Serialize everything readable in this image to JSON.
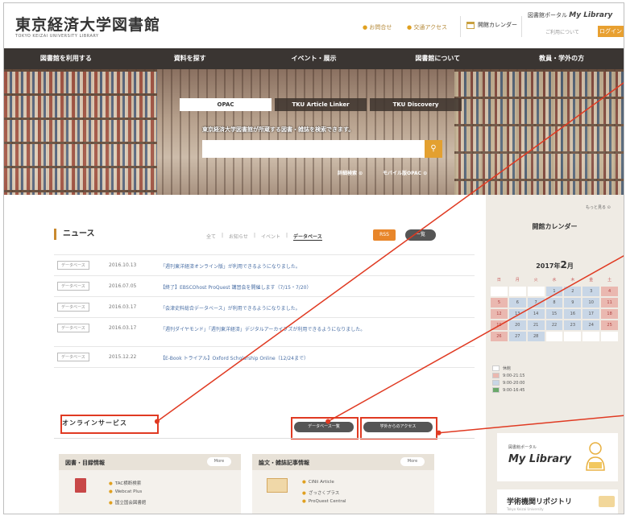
{
  "header": {
    "logo": "東京経済大学図書館",
    "logo_sub": "TOKYO KEIZAI UNIVERSITY LIBRARY",
    "links": [
      "お問合せ",
      "交通アクセス"
    ],
    "calendar_link": "開館カレンダー",
    "mylibrary_label": "図書館ポータル",
    "mylibrary_name": "My Library",
    "mylibrary_guide": "ご利用について",
    "login": "ログイン"
  },
  "nav": [
    "図書館を利用する",
    "資料を探す",
    "イベント・展示",
    "図書館について",
    "教員・学外の方"
  ],
  "search": {
    "tabs": [
      "OPAC",
      "TKU Article Linker",
      "TKU Discovery"
    ],
    "description": "東京経済大学図書館が所蔵する図書・雑誌を検索できます。",
    "button_icon": "search-icon",
    "advanced": "詳細検索",
    "mobile": "モバイル版OPAC"
  },
  "news": {
    "title": "ニュース",
    "filters": [
      "全て",
      "お知らせ",
      "イベント",
      "データベース"
    ],
    "rss": "RSS",
    "all": "一覧",
    "items": [
      {
        "tag": "データベース",
        "date": "2016.10.13",
        "text": "「週刊東洋経済オンライン版」が利用できるようになりました。"
      },
      {
        "tag": "データベース",
        "date": "2016.07.05",
        "text": "【終了】EBSCOhost ProQuest 講習会を開催します（7/15・7/20）"
      },
      {
        "tag": "データベース",
        "date": "2016.03.17",
        "text": "「会津史料総合データベース」が利用できるようになりました。"
      },
      {
        "tag": "データベース",
        "date": "2016.03.17",
        "text": "「週刊ダイヤモンド」「週刊東洋経済」デジタルアーカイブズが利用できるようになりました。"
      },
      {
        "tag": "データベース",
        "date": "2015.12.22",
        "text": "【E-Book トライアル】Oxford Scholarship Online（12/24まで）"
      }
    ]
  },
  "online": {
    "title": "オンラインサービス",
    "db_button": "データベース一覧",
    "offcampus_button": "学外からのアクセス",
    "panels": [
      {
        "title": "図書・目録情報",
        "more": "More",
        "items": [
          "TAC横断検索",
          "Webcat Plus",
          "国立国会図書館"
        ]
      },
      {
        "title": "論文・雑誌記事情報",
        "more": "More",
        "items": [
          "CiNii Article",
          "ざっさくプラス",
          "ProQuest Central"
        ]
      }
    ]
  },
  "sidebar": {
    "more": "もっと見る",
    "calendar_title": "開館カレンダー",
    "year_month_prefix": "2017年",
    "month": "2",
    "month_suffix": "月",
    "weekdays": [
      "日",
      "月",
      "火",
      "水",
      "木",
      "金",
      "土"
    ],
    "weeks": [
      [
        "",
        "",
        "",
        "1",
        "2",
        "3",
        "4"
      ],
      [
        "5",
        "6",
        "7",
        "8",
        "9",
        "10",
        "11"
      ],
      [
        "12",
        "13",
        "14",
        "15",
        "16",
        "17",
        "18"
      ],
      [
        "19",
        "20",
        "21",
        "22",
        "23",
        "24",
        "25"
      ],
      [
        "26",
        "27",
        "28",
        "",
        "",
        "",
        ""
      ]
    ],
    "legend": [
      "休館",
      "9:00-21:15",
      "9:00-20:00",
      "9:00-16:45"
    ],
    "mylibrary_sub": "図書館ポータル",
    "mylibrary": "My Library",
    "repository": "学術機関リポジトリ",
    "repository_sub": "Tokyo Keizai University"
  },
  "colors": {
    "accent": "#e3a030",
    "nav_bg": "#3a3532",
    "annotation": "#e03a22"
  }
}
